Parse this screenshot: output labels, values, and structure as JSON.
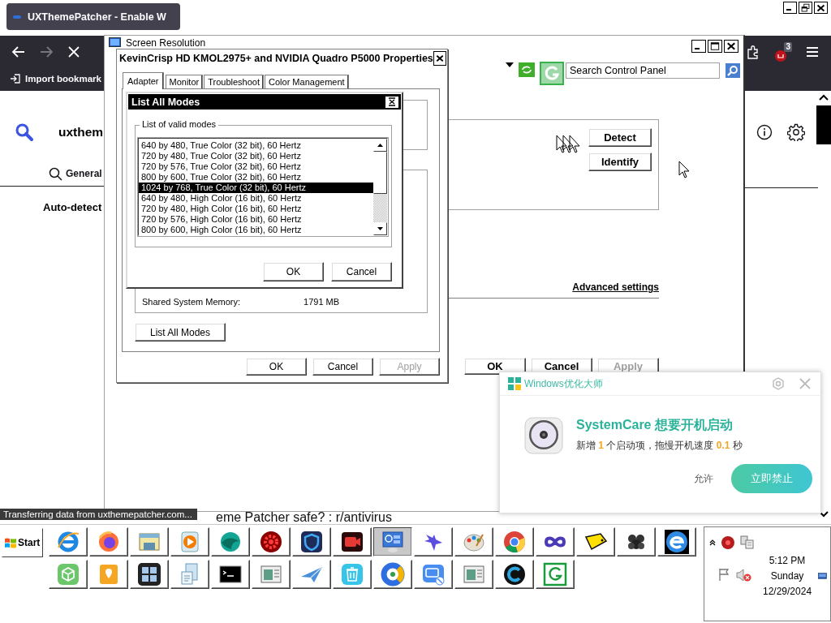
{
  "browser": {
    "tab": {
      "title": "UXThemePatcher - Enable W"
    },
    "toolbar": {
      "bookmark_button": "Import bookmark",
      "extension_badge": "3"
    },
    "page": {
      "search_query": "uxthem",
      "tab": "General",
      "heading": "Auto-detect"
    },
    "status": "Transferring data from uxthemepatcher.com...",
    "page_text": "eme Patcher safe? : r/antivirus"
  },
  "screen_resolution": {
    "title": "Screen Resolution",
    "search": {
      "placeholder": "Search Control Panel"
    },
    "buttons": [
      "Detect",
      "Identify"
    ],
    "link": "Advanced settings",
    "footer_buttons": [
      {
        "label": "OK",
        "disabled": false
      },
      {
        "label": "Cancel",
        "disabled": false
      },
      {
        "label": "Apply",
        "disabled": true
      }
    ]
  },
  "properties": {
    "title": "KevinCrisp HD KMOL2975+ and NVIDIA Quadro P5000 Properties",
    "tabs": [
      {
        "label": "Adapter",
        "selected": true
      },
      {
        "label": "Monitor",
        "selected": false
      },
      {
        "label": "Troubleshoot",
        "selected": false
      },
      {
        "label": "Color Management",
        "selected": false
      }
    ],
    "memory": {
      "label": "Shared System Memory:",
      "value": "1791 MB"
    },
    "list_button": "List All Modes",
    "buttons": [
      {
        "label": "OK",
        "disabled": false
      },
      {
        "label": "Cancel",
        "disabled": false
      },
      {
        "label": "Apply",
        "disabled": true
      }
    ]
  },
  "list_modes": {
    "title": "List All Modes",
    "group_label": "List of valid modes",
    "modes": [
      {
        "label": "640 by 480, True Color (32 bit), 60 Hertz",
        "selected": false
      },
      {
        "label": "720 by 480, True Color (32 bit), 60 Hertz",
        "selected": false
      },
      {
        "label": "720 by 576, True Color (32 bit), 60 Hertz",
        "selected": false
      },
      {
        "label": "800 by 600, True Color (32 bit), 60 Hertz",
        "selected": false
      },
      {
        "label": "1024 by 768, True Color (32 bit), 60 Hertz",
        "selected": true
      },
      {
        "label": "640 by 480, High Color (16 bit), 60 Hertz",
        "selected": false
      },
      {
        "label": "720 by 480, High Color (16 bit), 60 Hertz",
        "selected": false
      },
      {
        "label": "720 by 576, High Color (16 bit), 60 Hertz",
        "selected": false
      },
      {
        "label": "800 by 600, High Color (16 bit), 60 Hertz",
        "selected": false
      }
    ],
    "buttons": [
      "OK",
      "Cancel"
    ]
  },
  "popup": {
    "app_name": "Windows优化大师",
    "title": "SystemCare 想要开机启动",
    "message": "新增 **1** 个启动项，拖慢开机速度 **0.1** 秒",
    "buttons": [
      {
        "label": "允许",
        "kind": "text"
      },
      {
        "label": "立即禁止",
        "kind": "primary"
      }
    ]
  },
  "taskbar": {
    "start": "Start",
    "buttons": [
      {
        "kind": "ie",
        "selected": false
      },
      {
        "kind": "fox",
        "selected": false
      },
      {
        "kind": "folder",
        "selected": false
      },
      {
        "kind": "media",
        "selected": false
      },
      {
        "kind": "wave",
        "selected": false
      },
      {
        "kind": "gear",
        "selected": false
      },
      {
        "kind": "shield",
        "selected": false
      },
      {
        "kind": "camera",
        "selected": false
      },
      {
        "kind": "display",
        "selected": true
      },
      {
        "kind": "bird",
        "selected": false
      },
      {
        "kind": "palette",
        "selected": false
      },
      {
        "kind": "chrome",
        "selected": false
      },
      {
        "kind": "infinity",
        "selected": false
      },
      {
        "kind": "tag",
        "selected": false
      },
      {
        "kind": "berry",
        "selected": false
      },
      {
        "kind": "edge",
        "selected": false
      },
      {
        "kind": "cube",
        "selected": false
      },
      {
        "kind": "pin",
        "selected": false
      },
      {
        "kind": "grid",
        "selected": false
      },
      {
        "kind": "document",
        "selected": false
      },
      {
        "kind": "terminal",
        "selected": false
      },
      {
        "kind": "window",
        "selected": false
      },
      {
        "kind": "plane",
        "selected": false
      },
      {
        "kind": "trash",
        "selected": false
      },
      {
        "kind": "ring",
        "selected": false
      },
      {
        "kind": "block",
        "selected": false
      },
      {
        "kind": "window",
        "selected": false
      },
      {
        "kind": "darkring",
        "selected": false
      },
      {
        "kind": "spiral",
        "selected": false
      }
    ],
    "clock": {
      "time": "5:12 PM",
      "day": "Sunday",
      "date": "12/29/2024"
    }
  }
}
